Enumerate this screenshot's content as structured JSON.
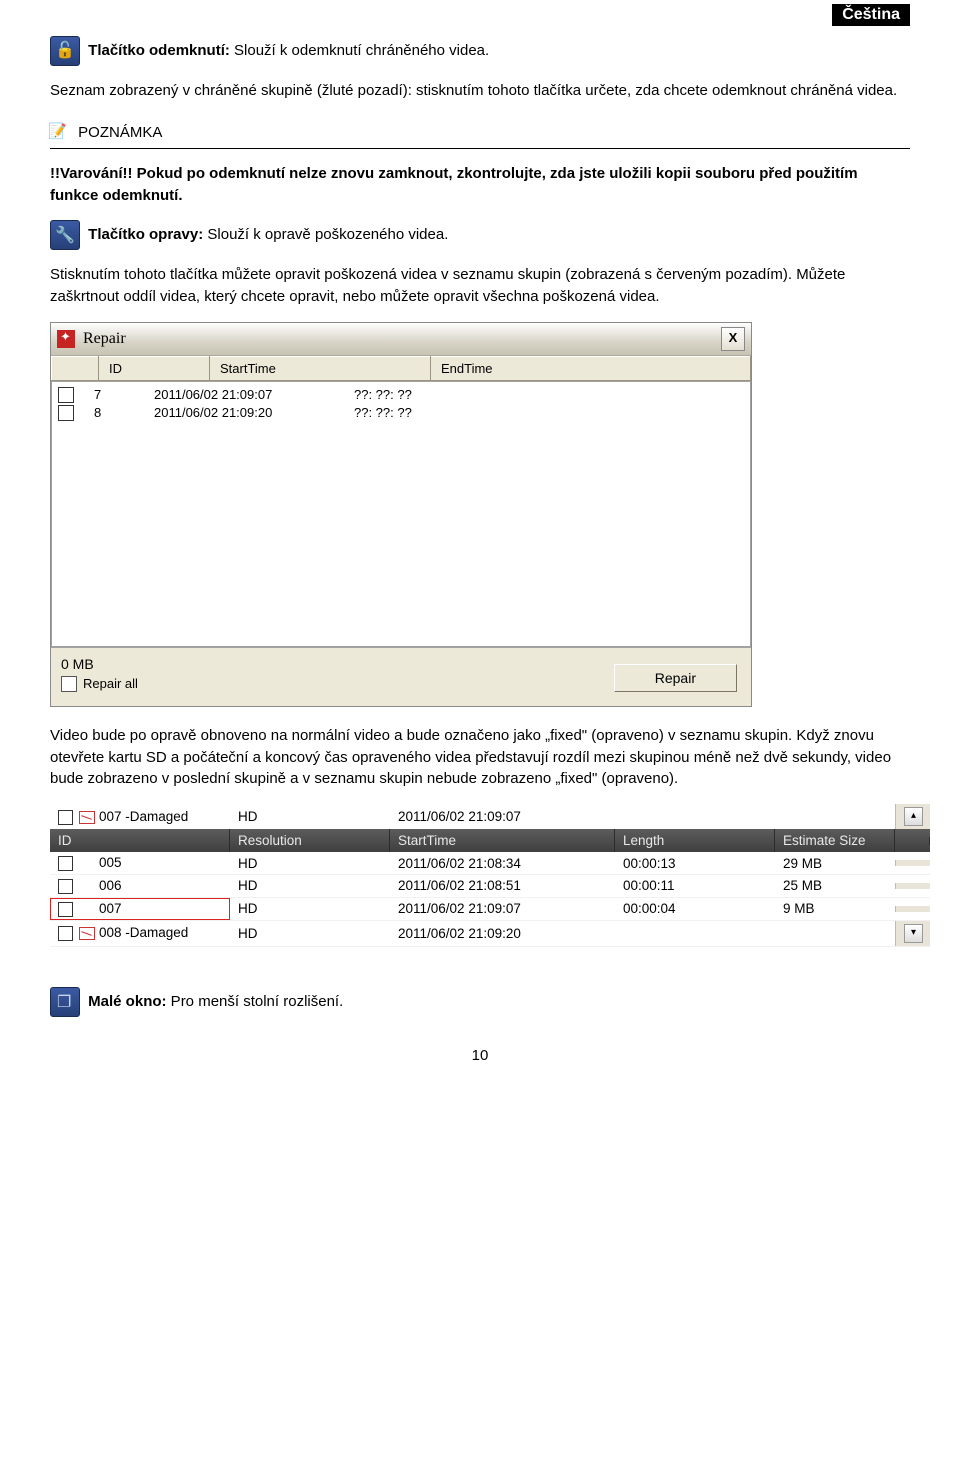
{
  "lang_badge": "Čeština",
  "unlock": {
    "title_bold": "Tlačítko odemknutí:",
    "title_rest": " Slouží k odemknutí chráněného videa.",
    "para": "Seznam zobrazený v chráněné skupině (žluté pozadí): stisknutím tohoto tlačítka určete, zda chcete odemknout chráněná videa."
  },
  "note": {
    "label": "POZNÁMKA",
    "warn_bold": "!!Varování!! Pokud po odemknutí nelze znovu zamknout, zkontrolujte, zda jste uložili kopii souboru před použitím funkce odemknutí."
  },
  "repair_btn_line": {
    "bold": "Tlačítko opravy:",
    "rest": " Slouží k opravě poškozeného videa."
  },
  "repair_para": "Stisknutím tohoto tlačítka můžete opravit poškozená videa v seznamu skupin (zobrazená s červeným pozadím). Můžete zaškrtnout oddíl videa, který chcete opravit, nebo můžete opravit všechna poškozená videa.",
  "repair_dialog": {
    "title": "Repair",
    "close": "X",
    "cols": {
      "id": "ID",
      "start": "StartTime",
      "end": "EndTime"
    },
    "rows": [
      {
        "id": "7",
        "start": "2011/06/02 21:09:07",
        "end": "??: ??: ??"
      },
      {
        "id": "8",
        "start": "2011/06/02 21:09:20",
        "end": "??: ??: ??"
      }
    ],
    "size": "0  MB",
    "repair_all": "Repair all",
    "button": "Repair"
  },
  "after_repair_para": "Video bude po opravě obnoveno na normální video a bude označeno jako „fixed\" (opraveno) v seznamu skupin. Když znovu otevřete kartu SD a počáteční a koncový čas opraveného videa představují rozdíl mezi skupinou méně než dvě sekundy, video bude zobrazeno v poslední skupině a v seznamu skupin nebude zobrazeno „fixed\" (opraveno).",
  "grouplist": {
    "group_row": {
      "name": "007 -Damaged",
      "res": "HD",
      "start": "2011/06/02 21:09:07"
    },
    "headers": {
      "id": "ID",
      "res": "Resolution",
      "start": "StartTime",
      "len": "Length",
      "est": "Estimate Size"
    },
    "rows": [
      {
        "id": "005",
        "res": "HD",
        "start": "2011/06/02 21:08:34",
        "len": "00:00:13",
        "est": "29 MB",
        "damaged": false,
        "red": false
      },
      {
        "id": "006",
        "res": "HD",
        "start": "2011/06/02 21:08:51",
        "len": "00:00:11",
        "est": "25 MB",
        "damaged": false,
        "red": false
      },
      {
        "id": "007",
        "res": "HD",
        "start": "2011/06/02 21:09:07",
        "len": "00:00:04",
        "est": "9 MB",
        "damaged": false,
        "red": true
      },
      {
        "id": "008 -Damaged",
        "res": "HD",
        "start": "2011/06/02 21:09:20",
        "len": "",
        "est": "",
        "damaged": true,
        "red": false
      }
    ]
  },
  "small_window": {
    "bold": "Malé okno:",
    "rest": " Pro menší stolní rozlišení."
  },
  "page_number": "10"
}
